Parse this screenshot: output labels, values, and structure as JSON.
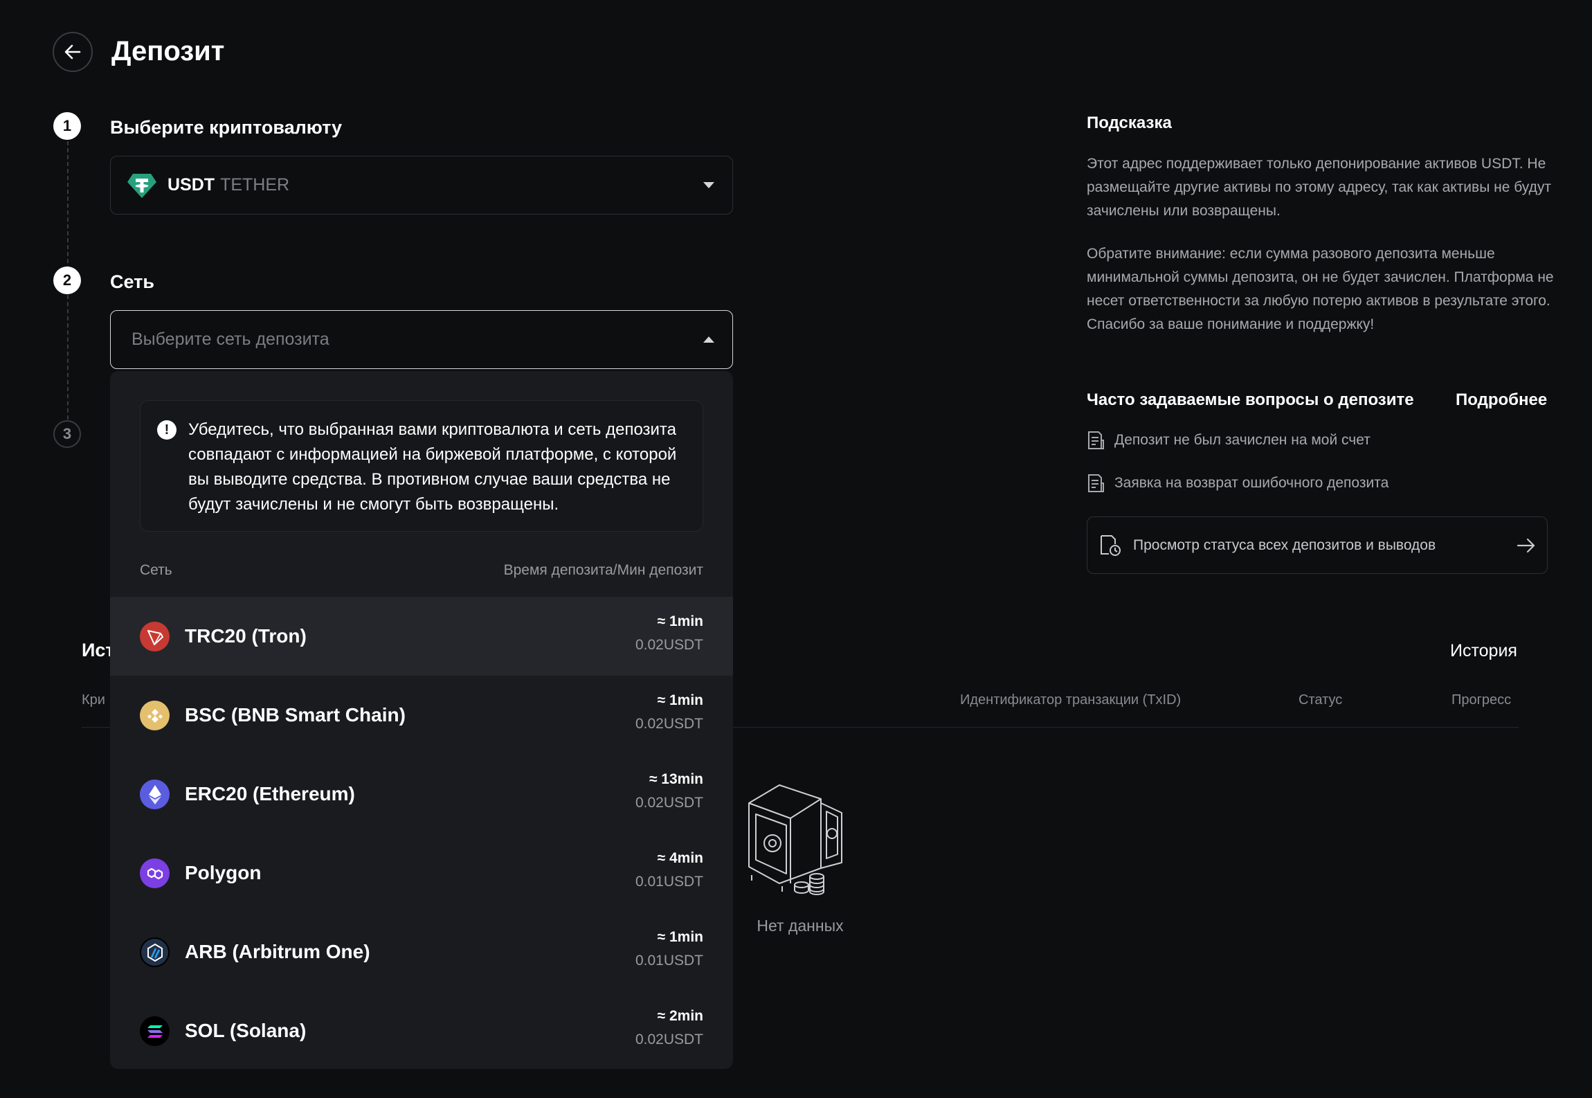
{
  "header": {
    "title": "Депозит"
  },
  "steps": [
    {
      "num": "1",
      "label": "Выберите криптовалюту"
    },
    {
      "num": "2",
      "label": "Сеть"
    },
    {
      "num": "3"
    }
  ],
  "coin_select": {
    "code": "USDT",
    "name": "TETHER"
  },
  "network_select": {
    "placeholder": "Выберите сеть депозита"
  },
  "dropdown": {
    "warning": "Убедитесь, что выбранная вами криптовалюта и сеть депозита совпадают с информацией на биржевой платформе, с которой вы выводите средства. В противном случае ваши средства не будут зачислены и не смогут быть возвращены.",
    "col_network": "Сеть",
    "col_time": "Время депозита/Мин депозит",
    "networks": [
      {
        "name": "TRC20 (Tron)",
        "time": "≈ 1min",
        "min": "0.02USDT",
        "icon": "tron-icon",
        "color": "#c73a33"
      },
      {
        "name": "BSC (BNB Smart Chain)",
        "time": "≈ 1min",
        "min": "0.02USDT",
        "icon": "bnb-icon",
        "color": "#e4bf6e"
      },
      {
        "name": "ERC20 (Ethereum)",
        "time": "≈ 13min",
        "min": "0.02USDT",
        "icon": "ethereum-icon",
        "color": "#5a5de0"
      },
      {
        "name": "Polygon",
        "time": "≈ 4min",
        "min": "0.01USDT",
        "icon": "polygon-icon",
        "color": "#7b3fe4"
      },
      {
        "name": "ARB (Arbitrum One)",
        "time": "≈ 1min",
        "min": "0.01USDT",
        "icon": "arbitrum-icon",
        "color": "#213147"
      },
      {
        "name": "SOL (Solana)",
        "time": "≈ 2min",
        "min": "0.02USDT",
        "icon": "solana-icon",
        "color": "#000000"
      }
    ]
  },
  "hint": {
    "title": "Подсказка",
    "p1": "Этот адрес поддерживает только депонирование активов USDT. Не размещайте другие активы по этому адресу, так как активы не будут зачислены или возвращены.",
    "p2": "Обратите внимание: если сумма разового депозита меньше минимальной суммы депозита, он не будет зачислен. Платформа не несет ответственности за любую потерю активов в результате этого. Спасибо за ваше понимание и поддержку!"
  },
  "faq": {
    "title": "Часто задаваемые вопросы о депозите",
    "more": "Подробнее",
    "items": [
      "Депозит не был зачислен на мой счет",
      "Заявка на возврат ошибочного депозита"
    ],
    "status_link": "Просмотр статуса всех депозитов и выводов"
  },
  "history": {
    "title": "Ист",
    "link": "История",
    "columns": [
      "Кри",
      "Идентификатор транзакции (TxID)",
      "Статус",
      "Прогресс"
    ],
    "empty": "Нет данных"
  },
  "colors": {
    "background": "#0d0e10",
    "dropdown": "#1a1b1f",
    "tether": "#26a17b"
  }
}
